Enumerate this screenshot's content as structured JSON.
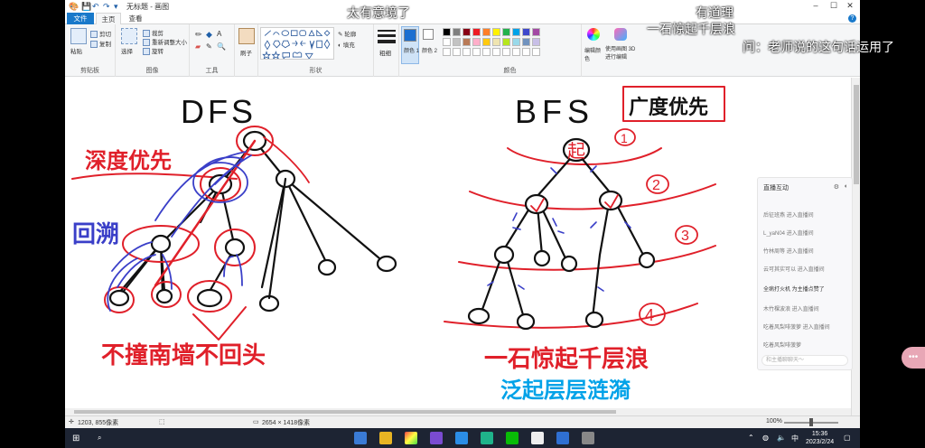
{
  "window": {
    "title": "无标题 - 画图",
    "controls": {
      "minimize": "–",
      "maximize": "☐",
      "close": "✕"
    }
  },
  "tabs": {
    "file": "文件",
    "home": "主页",
    "view": "查看",
    "help": "?"
  },
  "ribbon": {
    "clipboard": {
      "label": "剪贴板",
      "paste": "粘贴",
      "cut": "剪切",
      "copy": "复制"
    },
    "image": {
      "label": "图像",
      "select": "选择",
      "crop": "裁剪",
      "resize": "重新调整大小",
      "rotate": "旋转"
    },
    "tools": {
      "label": "工具"
    },
    "brushes": {
      "label": "刷子"
    },
    "shapes": {
      "label": "形状",
      "outline": "轮廓",
      "fill": "填充"
    },
    "size": {
      "label": "粗细"
    },
    "color1": {
      "label": "颜色 1"
    },
    "color2": {
      "label": "颜色 2"
    },
    "colors": {
      "label": "颜色",
      "edit": "编辑颜色",
      "paint3d": "使用画图 3D 进行编辑",
      "palette_row1": [
        "#000000",
        "#7f7f7f",
        "#880015",
        "#ed1c24",
        "#ff7f27",
        "#fff200",
        "#22b14c",
        "#00a2e8",
        "#3f48cc",
        "#a349a4"
      ],
      "palette_row2": [
        "#ffffff",
        "#c3c3c3",
        "#b97a57",
        "#ffaec9",
        "#ffc90e",
        "#efe4b0",
        "#b5e61d",
        "#99d9ea",
        "#7092be",
        "#c8bfe7"
      ]
    }
  },
  "canvas": {
    "dfs_title": "DFS",
    "dfs_subtitle": "深度优先",
    "backtrack": "回溯",
    "dfs_slogan": "不撞南墙不回头",
    "bfs_title": "BFS",
    "bfs_subtitle": "广度优先",
    "root_label": "起",
    "level_1": "1",
    "level_2": "2",
    "level_3": "3",
    "level_4": "4",
    "bfs_slogan_1": "一石惊起千层浪",
    "bfs_slogan_2": "泛起层层涟漪"
  },
  "status": {
    "cursor": "1203, 855像素",
    "size": "2654 × 1418像素",
    "zoom": "100%"
  },
  "chat": {
    "title": "直播互动",
    "messages": [
      "后征班燕 进入直播间",
      "L_yaN04 进入直播间",
      "竹林周等 进入直播间",
      "云可其实可以 进入直播间",
      "全病打火机 为主播点赞了",
      "木竹棵波浪 进入直播间",
      "吃着风梨啡菠萝 进入直播间",
      "吃着风梨啡菠萝"
    ],
    "input_placeholder": "和主播聊聊天～"
  },
  "danmaku": {
    "d1": "太有意境了",
    "d2": "有道理",
    "d3": "一石惊起千层浪",
    "d4": "问：老师说的这句话运用了"
  },
  "taskbar": {
    "time": "15:36",
    "date": "2023/2/24",
    "ime": "中"
  },
  "colors": {
    "accent": "#1979ca",
    "ink_red": "#e0202a",
    "ink_blue": "#3a3fc8",
    "ink_black": "#111111"
  }
}
